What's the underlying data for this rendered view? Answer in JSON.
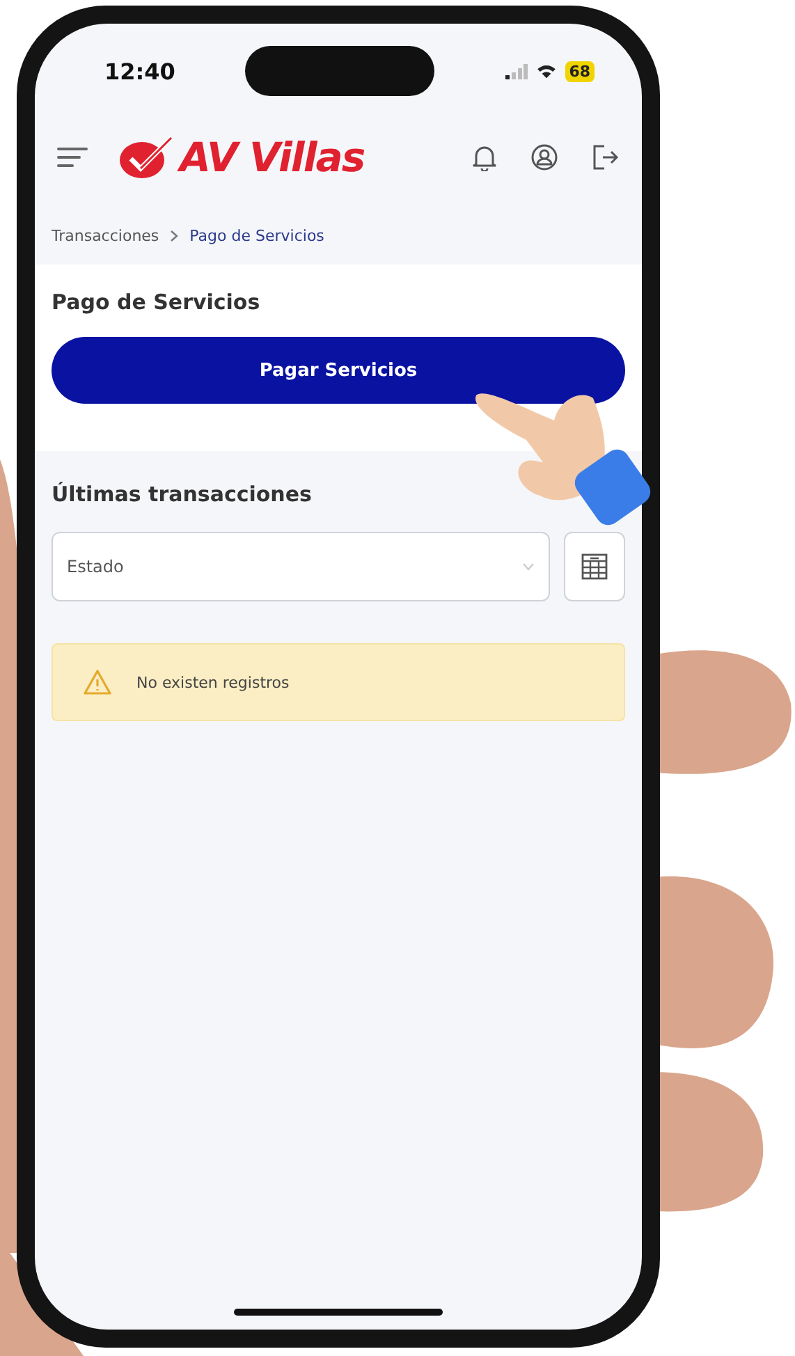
{
  "status_bar": {
    "time": "12:40",
    "battery": "68"
  },
  "header": {
    "logo": "AV Villas"
  },
  "breadcrumb": [
    {
      "label": "Transacciones",
      "current": false
    },
    {
      "label": "Pago de Servicios",
      "current": true
    }
  ],
  "section": {
    "title": "Pago de Servicios",
    "button": "Pagar Servicios"
  },
  "transactions": {
    "title": "Últimas transacciones",
    "filter": {
      "placeholder": "Estado"
    },
    "empty_message": "No existen registros"
  }
}
